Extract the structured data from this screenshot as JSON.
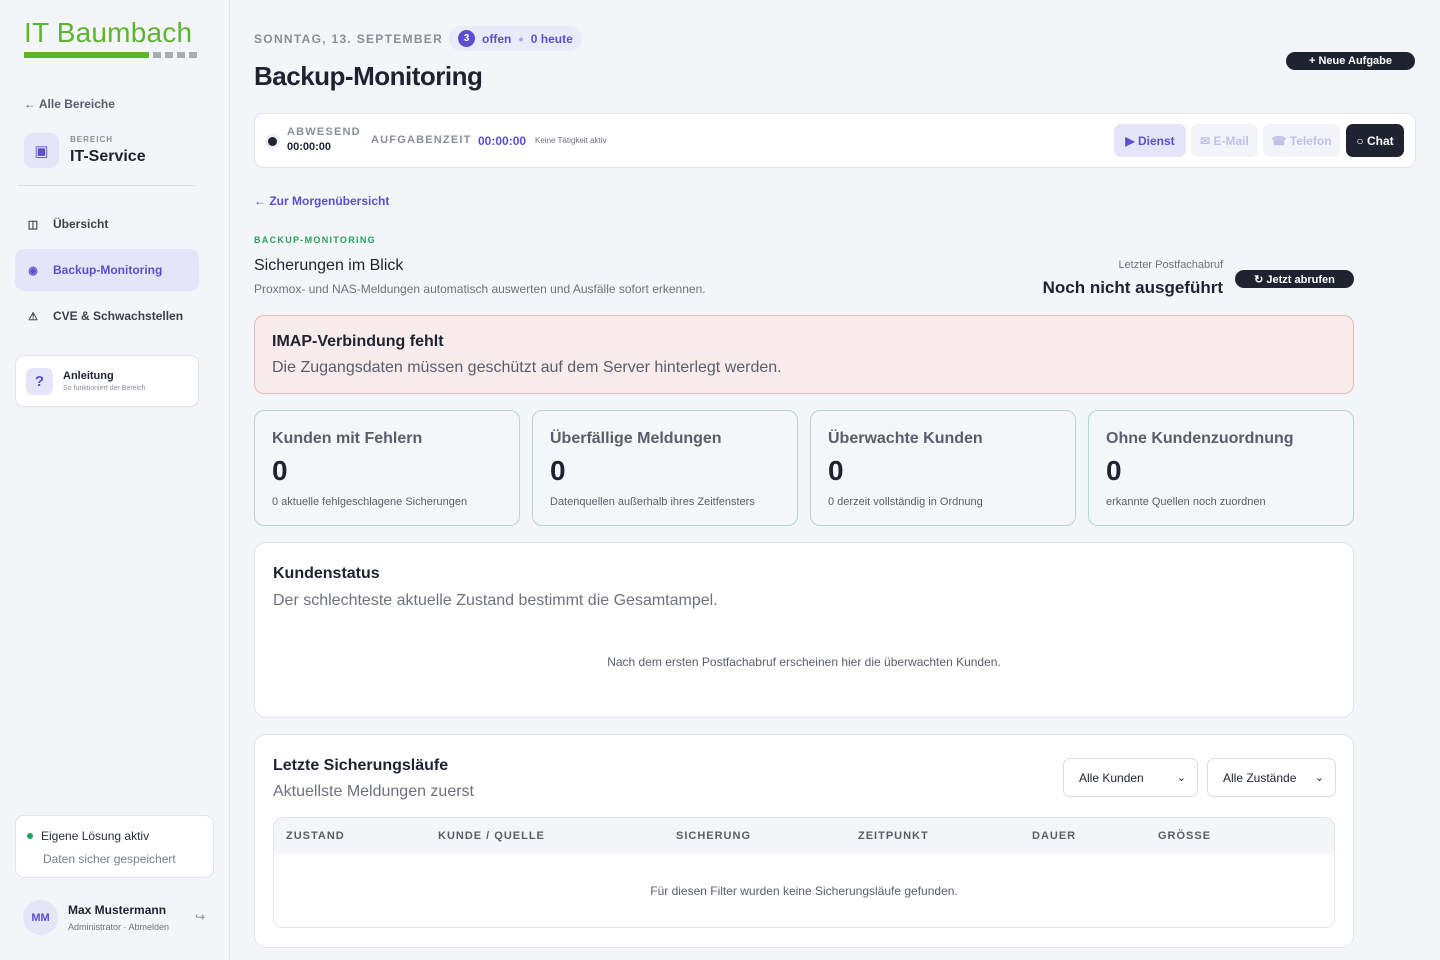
{
  "brand": {
    "name": "IT Baumbach",
    "color": "#5db52e"
  },
  "sidebar": {
    "back_label": "← Alle Bereiche",
    "area_kicker": "BEREICH",
    "area_name": "IT-Service",
    "area_icon": "monitor-icon",
    "items": [
      {
        "label": "Übersicht",
        "icon": "grid-icon",
        "active": false
      },
      {
        "label": "Backup-Monitoring",
        "icon": "target-icon",
        "active": true
      },
      {
        "label": "CVE & Schwachstellen",
        "icon": "warning-icon",
        "active": false
      }
    ],
    "guide": {
      "icon_glyph": "?",
      "title": "Anleitung",
      "subtitle": "So funktioniert der Bereich"
    },
    "status": {
      "title": "Eigene Lösung aktiv",
      "subtitle": "Daten sicher gespeichert"
    },
    "user": {
      "initials": "MM",
      "name": "Max Mustermann",
      "role": "Administrator · Abmelden"
    }
  },
  "header": {
    "date": "SONNTAG, 13. SEPTEMBER",
    "open_count": "3",
    "open_label": "offen",
    "today_label": "0 heute",
    "title": "Backup-Monitoring",
    "new_task_label": "+ Neue Aufgabe"
  },
  "timer": {
    "away_label": "ABWESEND",
    "away_time": "00:00:00",
    "task_label": "AUFGABENZEIT",
    "task_time": "00:00:00",
    "task_note": "Keine Tätigkeit aktiv",
    "buttons": {
      "dienst": "▶ Dienst",
      "email": "✉ E-Mail",
      "telefon": "☎ Telefon",
      "chat": "○ Chat"
    }
  },
  "section": {
    "back_link": "← Zur Morgenübersicht",
    "kicker": "BACKUP-MONITORING",
    "title": "Sicherungen im Blick",
    "subtitle": "Proxmox- und NAS-Meldungen automatisch auswerten und Ausfälle sofort erkennen.",
    "last_fetch_label": "Letzter Postfachabruf",
    "last_fetch_value": "Noch nicht ausgeführt",
    "fetch_button": "↻ Jetzt abrufen"
  },
  "alert": {
    "title": "IMAP-Verbindung fehlt",
    "text": "Die Zugangsdaten müssen geschützt auf dem Server hinterlegt werden."
  },
  "kpis": [
    {
      "title": "Kunden mit Fehlern",
      "value": "0",
      "subtitle": "0 aktuelle fehlgeschlagene Sicherungen"
    },
    {
      "title": "Überfällige Meldungen",
      "value": "0",
      "subtitle": "Datenquellen außerhalb ihres Zeitfensters"
    },
    {
      "title": "Überwachte Kunden",
      "value": "0",
      "subtitle": "0 derzeit vollständig in Ordnung"
    },
    {
      "title": "Ohne Kundenzuordnung",
      "value": "0",
      "subtitle": "erkannte Quellen noch zuordnen"
    }
  ],
  "customer_status": {
    "title": "Kundenstatus",
    "subtitle": "Der schlechteste aktuelle Zustand bestimmt die Gesamtampel.",
    "empty": "Nach dem ersten Postfachabruf erscheinen hier die überwachten Kunden."
  },
  "runs": {
    "title": "Letzte Sicherungsläufe",
    "subtitle": "Aktuellste Meldungen zuerst",
    "filter_customers": "Alle Kunden",
    "filter_states": "Alle Zustände",
    "columns": [
      "ZUSTAND",
      "KUNDE / QUELLE",
      "SICHERUNG",
      "ZEITPUNKT",
      "DAUER",
      "GRÖSSE"
    ],
    "empty": "Für diesen Filter wurden keine Sicherungsläufe gefunden."
  }
}
